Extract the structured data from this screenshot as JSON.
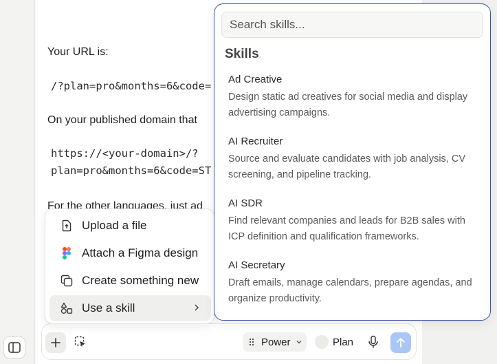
{
  "chat": {
    "url_intro": "Your URL is:",
    "url_code": "/?plan=pro&months=6&code=",
    "domain_intro": "On your published domain that",
    "code_line1": "https://<your-domain>/?",
    "code_line2": "plan=pro&months=6&code=ST",
    "other_langs": "For the other languages, just ad"
  },
  "attach_menu": {
    "items": [
      {
        "label": "Upload a file",
        "icon": "upload-file-icon"
      },
      {
        "label": "Attach a Figma design",
        "icon": "figma-icon"
      },
      {
        "label": "Create something new",
        "icon": "copy-new-icon"
      },
      {
        "label": "Use a skill",
        "icon": "shapes-icon"
      }
    ]
  },
  "skills_panel": {
    "search_placeholder": "Search skills...",
    "heading": "Skills",
    "items": [
      {
        "name": "Ad Creative",
        "description": "Design static ad creatives for social media and display advertising campaigns."
      },
      {
        "name": "AI Recruiter",
        "description": "Source and evaluate candidates with job analysis, CV screening, and pipeline tracking."
      },
      {
        "name": "AI SDR",
        "description": "Find relevant companies and leads for B2B sales with ICP definition and qualification frameworks."
      },
      {
        "name": "AI Secretary",
        "description": "Draft emails, manage calendars, prepare agendas, and organize productivity."
      }
    ]
  },
  "composer": {
    "mode_label": "Power",
    "plan_label": "Plan"
  },
  "colors": {
    "accent_border": "#3a56a8",
    "send_button": "#a9c6f5"
  }
}
